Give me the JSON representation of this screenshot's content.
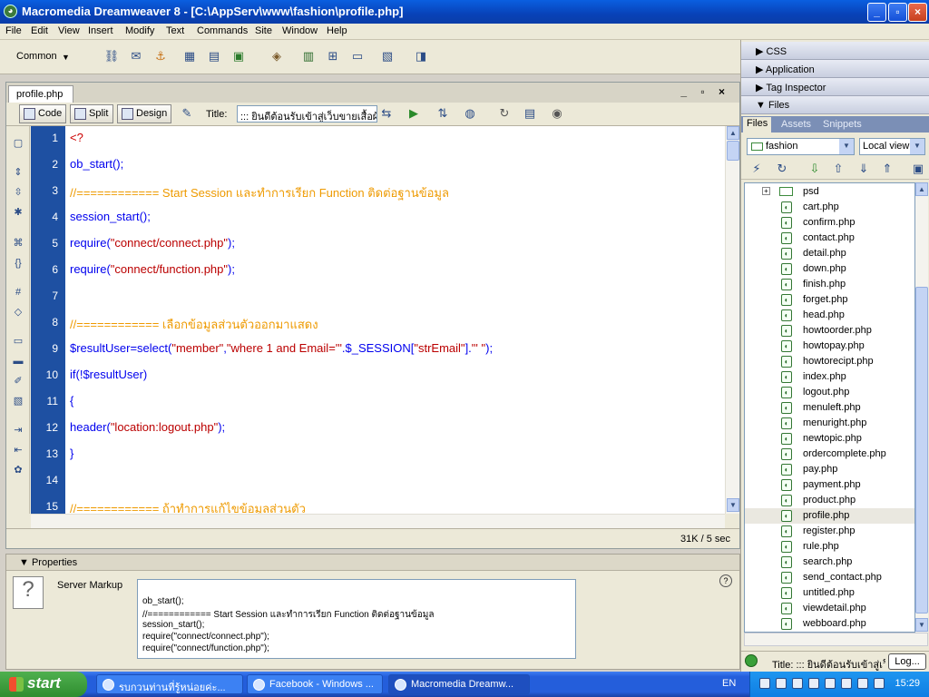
{
  "window": {
    "title": "Macromedia Dreamweaver 8 - [C:\\AppServ\\www\\fashion\\profile.php]",
    "app_icon": "dreamweaver-icon",
    "minimize": "_",
    "maximize": "▫",
    "close": "×"
  },
  "menu": [
    "File",
    "Edit",
    "View",
    "Insert",
    "Modify",
    "Text",
    "Commands",
    "Site",
    "Window",
    "Help"
  ],
  "insert_bar": {
    "category": "Common",
    "arrow": "▼"
  },
  "document": {
    "tab": "profile.php",
    "controls": "_ ▫ ×",
    "views": {
      "code": "Code",
      "split": "Split",
      "design": "Design"
    },
    "title_label": "Title:",
    "title_value": "::: ยินดีต้อนรับเข้าสู่เว็บขายเสื้อผ้",
    "status_size": "31K / 5 sec"
  },
  "code": {
    "lines": [
      {
        "n": "1",
        "html": "<span class='tag'>&lt;?</span>"
      },
      {
        "n": "2",
        "html": "ob_start();"
      },
      {
        "n": "3",
        "html": "<span class='cmt'>//============ Start Session และทำการเรียก Function ติดต่อฐานข้อมูล</span>"
      },
      {
        "n": "4",
        "html": "session_start();"
      },
      {
        "n": "5",
        "html": "require(<span class='str'>\"connect/connect.php\"</span>);"
      },
      {
        "n": "6",
        "html": "require(<span class='str'>\"connect/function.php\"</span>);"
      },
      {
        "n": "7",
        "html": ""
      },
      {
        "n": "8",
        "html": "<span class='cmt'>//============ เลือกข้อมูลส่วนตัวออกมาแสดง</span>"
      },
      {
        "n": "9",
        "html": "$resultUser=select(<span class='str'>\"member\"</span>,<span class='str'>\"where 1 and Email='\"</span>.$_SESSION[<span class='str'>\"strEmail\"</span>].<span class='str'>\"' \"</span>);"
      },
      {
        "n": "10",
        "html": "if(!$resultUser)"
      },
      {
        "n": "11",
        "html": "{"
      },
      {
        "n": "12",
        "html": "header(<span class='str'>\"location:logout.php\"</span>);"
      },
      {
        "n": "13",
        "html": "}"
      },
      {
        "n": "14",
        "html": ""
      },
      {
        "n": "15",
        "html": "<span class='cmt'>//============ ถ้าทำการแก้ไขข้อมูลส่วนตัว</span>"
      }
    ]
  },
  "properties": {
    "header": "Properties",
    "label": "Server Markup",
    "qmark": "?",
    "help": "?",
    "lines": [
      "ob_start();",
      "//============ Start Session และทำการเรียก Function ติดต่อฐานข้อมูล",
      "session_start();",
      "require(\"connect/connect.php\");",
      "require(\"connect/function.php\");"
    ]
  },
  "panels": {
    "css": "CSS",
    "application": "Application",
    "tag_inspector": "Tag Inspector",
    "files": "Files",
    "tabs": [
      "Files",
      "Assets",
      "Snippets"
    ],
    "site": "fashion",
    "view": "Local view",
    "folder": "psd",
    "files_list": [
      "cart.php",
      "confirm.php",
      "contact.php",
      "detail.php",
      "down.php",
      "finish.php",
      "forget.php",
      "head.php",
      "howtoorder.php",
      "howtopay.php",
      "howtorecipt.php",
      "index.php",
      "logout.php",
      "menuleft.php",
      "menuright.php",
      "newtopic.php",
      "ordercomplete.php",
      "pay.php",
      "payment.php",
      "product.php",
      "profile.php",
      "register.php",
      "rule.php",
      "search.php",
      "send_contact.php",
      "untitled.php",
      "viewdetail.php",
      "webboard.php"
    ],
    "selected_file": "profile.php",
    "status_title": "Title: ::: ยินดีต้อนรับเข้าสู่เว็",
    "log_button": "Log..."
  },
  "taskbar": {
    "start": "start",
    "tasks": [
      "รบกวนท่านที่รู้หน่อยค่ะ...",
      "Facebook - Windows ...",
      "Macromedia Dreamw..."
    ],
    "lang": "EN",
    "clock": "15:29"
  }
}
